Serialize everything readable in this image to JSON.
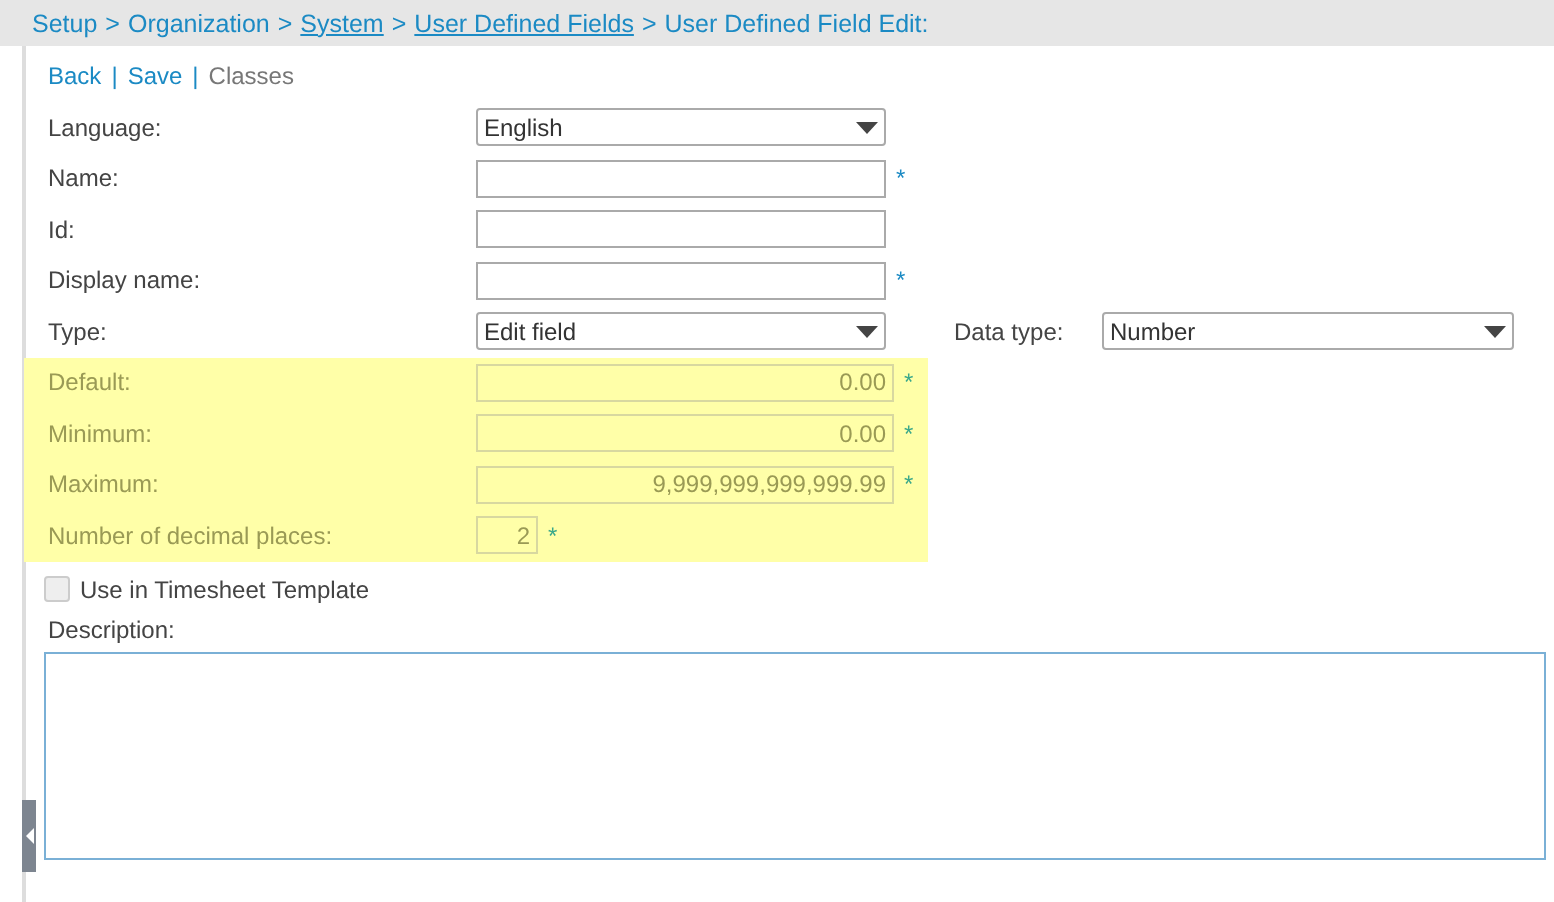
{
  "breadcrumb": [
    {
      "label": "Setup",
      "link": false,
      "separator": ">"
    },
    {
      "label": "Organization",
      "link": false,
      "separator": ">"
    },
    {
      "label": "System",
      "link": true,
      "separator": ">"
    },
    {
      "label": "User Defined Fields",
      "link": true,
      "separator": ">"
    },
    {
      "label": "User Defined Field Edit:",
      "link": false
    }
  ],
  "toolbar": [
    {
      "label": "Back",
      "disabled": false,
      "separator": "|"
    },
    {
      "label": "Save",
      "disabled": false,
      "separator": "|"
    },
    {
      "label": "Classes",
      "disabled": true
    }
  ],
  "fields": [
    {
      "kind": "select",
      "label": "Language:",
      "value": "English",
      "highlighted": false
    },
    {
      "kind": "text",
      "label": "Name:",
      "required_mark": "*",
      "highlighted": false
    },
    {
      "kind": "text",
      "label": "Id:",
      "highlighted": false
    },
    {
      "kind": "text",
      "label": "Display name:",
      "required_mark": "*",
      "highlighted": false
    },
    {
      "kind": "select",
      "label": "Type:",
      "value": "Edit field",
      "highlighted": false,
      "extra": {
        "label": "Data type:",
        "value": "Number"
      }
    },
    {
      "kind": "number",
      "label": "Default:",
      "value": "0.00",
      "required_mark": "*",
      "highlighted": true
    },
    {
      "kind": "number",
      "label": "Minimum:",
      "value": "0.00",
      "required_mark": "*",
      "highlighted": true
    },
    {
      "kind": "number",
      "label": "Maximum:",
      "value": "9,999,999,999,999.99",
      "required_mark": "*",
      "highlighted": true
    },
    {
      "kind": "small",
      "label": "Number of decimal places:",
      "value": "2",
      "required_mark": "*",
      "highlighted": true
    }
  ],
  "timesheet_checkbox": {
    "label": "Use in Timesheet Template",
    "checked": false,
    "disabled": true
  },
  "description": {
    "label": "Description:"
  }
}
